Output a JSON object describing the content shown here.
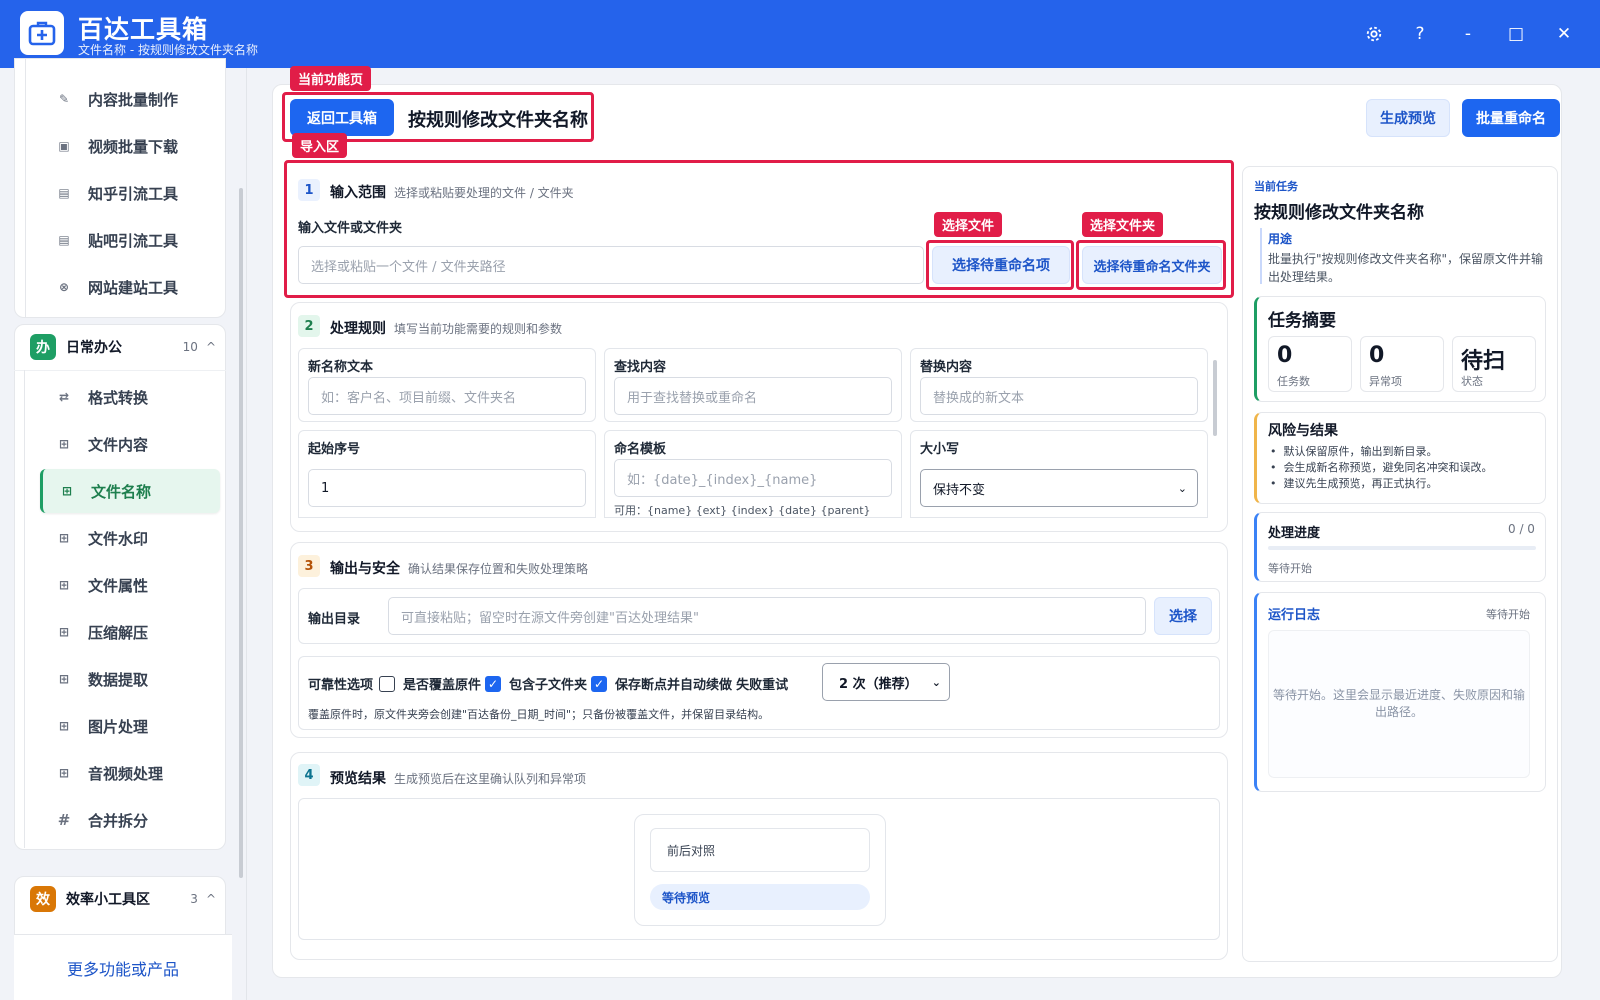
{
  "app": {
    "title": "百达工具箱",
    "subtitle": "文件名称 - 按规则修改文件夹名称",
    "settings_icon": "gear-icon",
    "help_label": "?",
    "minimize_label": "-",
    "maximize_label": "□",
    "close_label": "✕"
  },
  "sidebar": {
    "group1_items": [
      {
        "label": "内容批量制作",
        "icon": "pen-icon"
      },
      {
        "label": "视频批量下载",
        "icon": "video-icon"
      },
      {
        "label": "知乎引流工具",
        "icon": "zhihu-icon"
      },
      {
        "label": "贴吧引流工具",
        "icon": "tieba-icon"
      },
      {
        "label": "网站建站工具",
        "icon": "globe-icon"
      }
    ],
    "group2": {
      "badge": "办",
      "title": "日常办公",
      "count": "10",
      "chevron": "^",
      "items": [
        {
          "label": "格式转换",
          "icon": "swap-icon"
        },
        {
          "label": "文件内容",
          "icon": "grid-icon"
        },
        {
          "label": "文件名称",
          "icon": "grid-icon",
          "active": true
        },
        {
          "label": "文件水印",
          "icon": "grid-icon"
        },
        {
          "label": "文件属性",
          "icon": "grid-icon"
        },
        {
          "label": "压缩解压",
          "icon": "grid-icon"
        },
        {
          "label": "数据提取",
          "icon": "grid-icon"
        },
        {
          "label": "图片处理",
          "icon": "grid-icon"
        },
        {
          "label": "音视频处理",
          "icon": "grid-icon"
        },
        {
          "label": "合并拆分",
          "icon": "hash-icon"
        }
      ]
    },
    "group3": {
      "badge": "效",
      "title": "效率小工具区",
      "count": "3",
      "chevron": "^"
    },
    "more_label": "更多功能或产品",
    "colors": {
      "active_bg": "#e6f6ee",
      "active_text": "#1e7f4e",
      "office_badge": "#1e9e64",
      "efficiency_badge": "#d97706"
    }
  },
  "main": {
    "tag_current": "当前功能页",
    "tag_import": "导入区",
    "tag_select_file": "选择文件",
    "tag_select_folder": "选择文件夹",
    "back_label": "返回工具箱",
    "page_title": "按规则修改文件夹名称",
    "preview_btn": "生成预览",
    "rename_btn": "批量重命名",
    "sec1": {
      "num": "1",
      "title": "输入范围",
      "hint": "选择或粘贴要处理的文件 / 文件夹",
      "label": "输入文件或文件夹",
      "placeholder": "选择或粘贴一个文件 / 文件夹路径",
      "select_items": "选择待重命名项",
      "select_folder": "选择待重命名文件夹"
    },
    "sec2": {
      "num": "2",
      "title": "处理规则",
      "hint": "填写当前功能需要的规则和参数",
      "new_name_label": "新名称文本",
      "new_name_placeholder": "如：客户名、项目前缀、文件夹名",
      "find_label": "查找内容",
      "find_placeholder": "用于查找替换或重命名",
      "replace_label": "替换内容",
      "replace_placeholder": "替换成的新文本",
      "start_label": "起始序号",
      "start_value": "1",
      "template_label": "命名模板",
      "template_placeholder": "如：{date}_{index}_{name}",
      "template_help": "可用：{name} {ext} {index} {date} {parent}",
      "case_label": "大小写",
      "case_value": "保持不变"
    },
    "sec3": {
      "num": "3",
      "title": "输出与安全",
      "hint": "确认结果保存位置和失败处理策略",
      "out_label": "输出目录",
      "out_placeholder": "可直接粘贴；留空时在源文件旁创建\"百达处理结果\"",
      "out_btn": "选择",
      "reliability_label": "可靠性选项",
      "overwrite_label": "是否覆盖原件",
      "overwrite_checked": false,
      "subfolder_label": "包含子文件夹",
      "subfolder_checked": true,
      "resume_label": "保存断点并自动续做",
      "resume_checked": true,
      "retry_label": "失败重试",
      "retry_value": "2 次（推荐）",
      "note": "覆盖原件时，原文件夹旁会创建\"百达备份_日期_时间\"；只备份被覆盖文件，并保留目录结构。"
    },
    "sec4": {
      "num": "4",
      "title": "预览结果",
      "hint": "生成预览后在这里确认队列和异常项",
      "compare_label": "前后对照",
      "waiting_label": "等待预览"
    }
  },
  "right": {
    "current_task_label": "当前任务",
    "task_title": "按规则修改文件夹名称",
    "purpose_label": "用途",
    "purpose_text": "批量执行\"按规则修改文件夹名称\"，保留原文件并输出处理结果。",
    "summary_title": "任务摘要",
    "stats": [
      {
        "value": "0",
        "label": "任务数"
      },
      {
        "value": "0",
        "label": "异常项"
      },
      {
        "value": "待扫",
        "label": "状态"
      }
    ],
    "risk_title": "风险与结果",
    "risk_items": [
      "默认保留原件，输出到新目录。",
      "会生成新名称预览，避免同名冲突和误改。",
      "建议先生成预览，再正式执行。"
    ],
    "progress_title": "处理进度",
    "progress_count": "0 / 0",
    "progress_fraction": 0,
    "progress_status": "等待开始",
    "log_title": "运行日志",
    "log_status": "等待开始",
    "log_placeholder": "等待开始。这里会显示最近进度、失败原因和输出路径。"
  }
}
